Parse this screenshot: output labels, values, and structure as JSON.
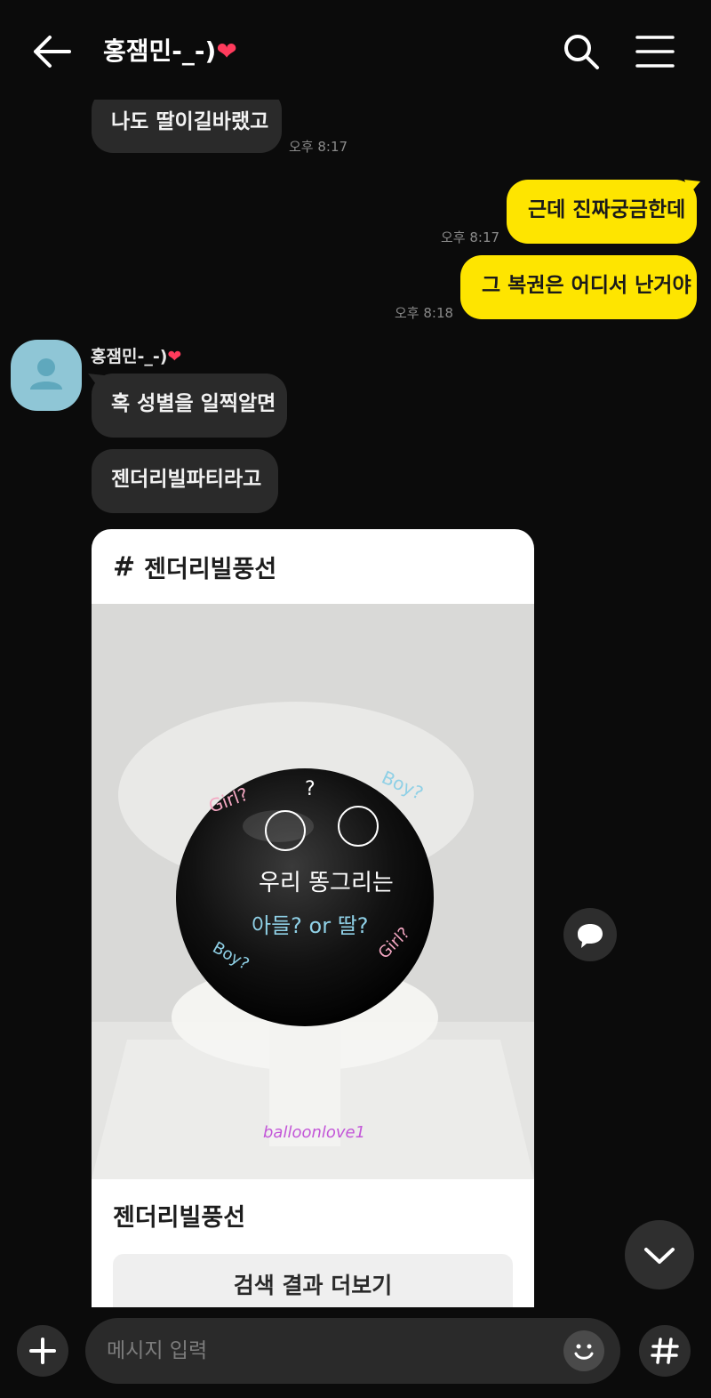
{
  "header": {
    "title": "홍잼민-_-)",
    "title_heart": "❤",
    "back_icon": "arrow-left-icon",
    "search_icon": "search-icon",
    "menu_icon": "hamburger-menu-icon"
  },
  "messages": [
    {
      "direction": "in",
      "text": "나도 딸이길바랬고",
      "time": "오후 8:17"
    },
    {
      "direction": "out",
      "text": "근데 진짜궁금한데",
      "time": "오후 8:17"
    },
    {
      "direction": "out",
      "text": "그 복권은 어디서 난거야",
      "time": "오후 8:18"
    },
    {
      "direction": "in",
      "text": "혹 성별을 일찍알면"
    },
    {
      "direction": "in",
      "text": "젠더리빌파티라고"
    }
  ],
  "sender": {
    "name": "홍잼민-_-)",
    "heart": "❤",
    "avatar_icon": "default-profile-icon"
  },
  "search_card": {
    "hashtag": "#",
    "header_text": "젠더리빌풍선",
    "image": {
      "balloon_text_line1": "우리 똥그리는",
      "balloon_text_line2": "아들? or 딸?",
      "girl_label": "Girl?",
      "boy_label": "Boy?",
      "question_mark": "?",
      "watermark": "balloonlove1"
    },
    "caption": "젠더리빌풍선",
    "more_button": "검색 결과 더보기"
  },
  "share_icon": "chat-bubble-icon",
  "scroll_down_icon": "chevron-down-icon",
  "input_bar": {
    "plus_icon": "plus-icon",
    "placeholder": "메시지 입력",
    "emoji_icon": "emoji-icon",
    "hash_button": "#"
  },
  "colors": {
    "background": "#0b0b0b",
    "incoming_bubble": "#2a2a2a",
    "outgoing_bubble": "#fee500",
    "avatar": "#8fc6d6",
    "heart": "#ff3b5c"
  }
}
